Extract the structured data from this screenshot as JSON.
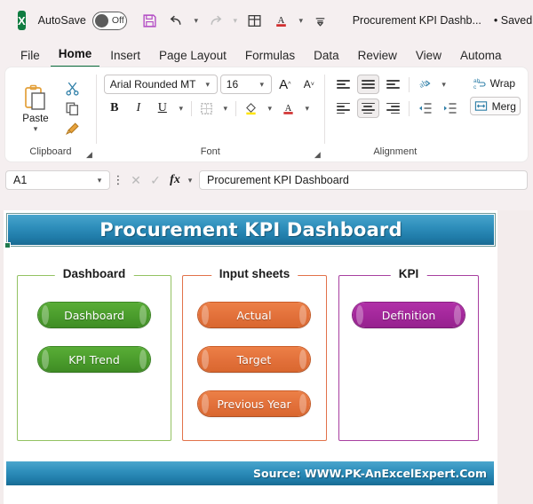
{
  "titlebar": {
    "app_icon": "excel-logo",
    "autosave_label": "AutoSave",
    "autosave_state": "Off",
    "document_title": "Procurement KPI Dashb...",
    "saved_status": "• Saved",
    "quick_access": [
      {
        "name": "save-icon",
        "glyph": "💾"
      },
      {
        "name": "undo-icon",
        "glyph": "↶"
      },
      {
        "name": "redo-icon",
        "glyph": "↷"
      },
      {
        "name": "table-icon",
        "glyph": "⊞"
      },
      {
        "name": "font-color-icon",
        "glyph": "A"
      },
      {
        "name": "customize-quick-access-icon",
        "glyph": "⌵"
      }
    ]
  },
  "ribbon_tabs": [
    {
      "label": "File",
      "active": false
    },
    {
      "label": "Home",
      "active": true
    },
    {
      "label": "Insert",
      "active": false
    },
    {
      "label": "Page Layout",
      "active": false
    },
    {
      "label": "Formulas",
      "active": false
    },
    {
      "label": "Data",
      "active": false
    },
    {
      "label": "Review",
      "active": false
    },
    {
      "label": "View",
      "active": false
    },
    {
      "label": "Automa",
      "active": false
    }
  ],
  "ribbon": {
    "clipboard": {
      "group_label": "Clipboard",
      "paste_label": "Paste",
      "cut_icon": "scissors-icon",
      "copy_icon": "copy-icon",
      "format_painter_icon": "format-painter-icon",
      "launcher_icon": "dialog-launcher-icon"
    },
    "font": {
      "group_label": "Font",
      "font_name": "Arial Rounded MT",
      "font_size": "16",
      "grow_font": "A",
      "shrink_font": "A",
      "bold": "B",
      "italic": "I",
      "underline": "U",
      "borders_icon": "borders-icon",
      "fill_color_icon": "fill-color-icon",
      "font_color": "A",
      "launcher_icon": "dialog-launcher-icon"
    },
    "alignment": {
      "group_label": "Alignment",
      "wrap_text_label": "Wrap",
      "merge_label": "Merg",
      "orientation_icon": "orientation-icon",
      "decrease_indent_icon": "decrease-indent-icon",
      "increase_indent_icon": "increase-indent-icon"
    }
  },
  "formula_bar": {
    "name_box": "A1",
    "cancel_icon": "cancel-icon",
    "enter_icon": "confirm-icon",
    "fx_icon": "fx-icon",
    "formula_value": "Procurement KPI Dashboard"
  },
  "dashboard": {
    "title": "Procurement KPI Dashboard",
    "source": "Source: WWW.PK-AnExcelExpert.Com",
    "groups": [
      {
        "legend": "Dashboard",
        "color": "#93c262",
        "buttons": [
          {
            "label": "Dashboard"
          },
          {
            "label": "KPI Trend"
          }
        ]
      },
      {
        "legend": "Input sheets",
        "color": "#e2724a",
        "buttons": [
          {
            "label": "Actual"
          },
          {
            "label": "Target"
          },
          {
            "label": "Previous Year"
          }
        ]
      },
      {
        "legend": "KPI",
        "color": "#a83fa0",
        "buttons": [
          {
            "label": "Definition"
          }
        ]
      }
    ]
  },
  "colors": {
    "header_blue_light": "#4ba6cd",
    "header_blue_dark": "#18688f",
    "green": "#4a9c2c",
    "orange": "#e2703a",
    "purple": "#a2279a",
    "excel_green": "#107c41"
  }
}
